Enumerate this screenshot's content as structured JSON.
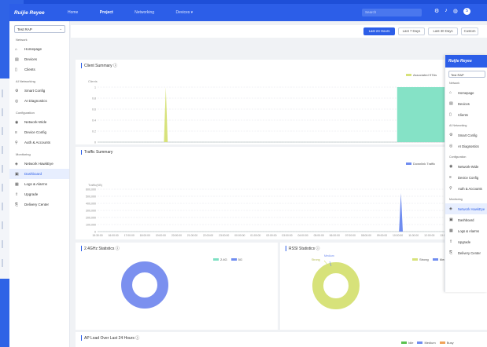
{
  "brand": {
    "logo": "Ruijie Reyee"
  },
  "topbar": {
    "nav": [
      {
        "label": "Home"
      },
      {
        "label": "Project"
      },
      {
        "label": "Networking"
      },
      {
        "label": "Devices ▾"
      }
    ],
    "search_placeholder": "Search",
    "avatar": "S"
  },
  "sidebar": {
    "site": "Test RAP",
    "sections": [
      {
        "title": "Network",
        "items": [
          {
            "label": "Homepage",
            "icon": "home-icon"
          },
          {
            "label": "Devices",
            "icon": "devices-icon"
          },
          {
            "label": "Clients",
            "icon": "clients-icon"
          }
        ]
      },
      {
        "title": "AI Networking",
        "items": [
          {
            "label": "Smart Config",
            "icon": "smart-config-icon"
          },
          {
            "label": "AI Diagnostics",
            "icon": "diagnostics-icon"
          }
        ]
      },
      {
        "title": "Configuration",
        "items": [
          {
            "label": "Network-Wide",
            "icon": "network-wide-icon"
          },
          {
            "label": "Device Config",
            "icon": "device-config-icon"
          },
          {
            "label": "Auth & Accounts",
            "icon": "auth-icon"
          }
        ]
      },
      {
        "title": "Monitoring",
        "items": [
          {
            "label": "Network HawkEye",
            "icon": "hawkeye-icon"
          },
          {
            "label": "Dashboard",
            "icon": "dashboard-icon",
            "active": true
          },
          {
            "label": "Logs & Alarms",
            "icon": "logs-icon"
          },
          {
            "label": "Upgrade",
            "icon": "upgrade-icon"
          },
          {
            "label": "Delivery Center",
            "icon": "delivery-icon"
          }
        ]
      }
    ]
  },
  "range": {
    "buttons": [
      "Last 24 Hours",
      "Last 7 Days",
      "Last 30 Days",
      "Custom"
    ],
    "active": 0
  },
  "client_summary": {
    "title": "Client Summary ⓘ",
    "legend": "Associated STAs",
    "ylabel": "Clients",
    "yticks": [
      "1",
      "0.8",
      "0.6",
      "0.4",
      "0.2",
      "0"
    ],
    "color": "#7ee0c3",
    "spike_color": "#d7e27a"
  },
  "traffic_summary": {
    "title": "Traffic Summary",
    "legend": "Downlink Traffic",
    "ylabel": "Traffic(KB)",
    "yticks": [
      "600,000",
      "500,000",
      "400,000",
      "300,000",
      "200,000",
      "100,000",
      "0"
    ],
    "color": "#6f8cf0"
  },
  "times": [
    "15:30:00",
    "16:00:00",
    "17:00:00",
    "18:00:00",
    "19:00:00",
    "20:00:00",
    "21:00:00",
    "22:00:00",
    "23:00:00",
    "00:00:00",
    "01:00:00",
    "02:00:00",
    "03:00:00",
    "04:00:00",
    "05:00:00",
    "06:00:00",
    "07:00:00",
    "08:00:00",
    "09:00:00",
    "10:00:00",
    "11:00:00",
    "12:00:00",
    "13:00:00",
    "14:00:00",
    "15:00:00"
  ],
  "ghz24": {
    "title": "2.4GHz Statistics ⓘ",
    "legend": [
      "2.4G",
      "5G"
    ],
    "colors": [
      "#7ee0c3",
      "#6f8cf0"
    ],
    "donut_color": "#7b90ef"
  },
  "rssi": {
    "title": "RSSI Statistics ⓘ",
    "legend": [
      "Strong",
      "Medium"
    ],
    "colors": [
      "#d7e27a",
      "#6f8cf0"
    ],
    "donut_color": "#d7e27a",
    "callout_left": "Strong",
    "callout_top": "Medium"
  },
  "ap_load": {
    "title": "AP Load Over Last 24 Hours ⓘ",
    "legend": [
      "Idle",
      "Medium",
      "Busy"
    ],
    "colors": [
      "#5cc14f",
      "#6f8cf0",
      "#f0a35a"
    ],
    "bars": 32
  },
  "overlay": {
    "logo": "Ruijie Reyee",
    "site": "Test RAP",
    "sections": [
      {
        "title": "Network",
        "items": [
          {
            "label": "Homepage",
            "icon": "home-icon"
          },
          {
            "label": "Devices",
            "icon": "devices-icon"
          },
          {
            "label": "Clients",
            "icon": "clients-icon"
          }
        ]
      },
      {
        "title": "AI Networking",
        "items": [
          {
            "label": "Smart Config",
            "icon": "smart-config-icon"
          },
          {
            "label": "AI Diagnostics",
            "icon": "diagnostics-icon"
          }
        ]
      },
      {
        "title": "Configuration",
        "items": [
          {
            "label": "Network-Wide",
            "icon": "network-wide-icon"
          },
          {
            "label": "Device Config",
            "icon": "device-config-icon"
          },
          {
            "label": "Auth & Accounts",
            "icon": "auth-icon"
          }
        ]
      },
      {
        "title": "Monitoring",
        "items": [
          {
            "label": "Network HawkEye",
            "icon": "hawkeye-icon",
            "active": true
          },
          {
            "label": "Dashboard",
            "icon": "dashboard-icon"
          },
          {
            "label": "Logs & Alarms",
            "icon": "logs-icon"
          },
          {
            "label": "Upgrade",
            "icon": "upgrade-icon"
          },
          {
            "label": "Delivery Center",
            "icon": "delivery-icon"
          }
        ]
      }
    ]
  }
}
